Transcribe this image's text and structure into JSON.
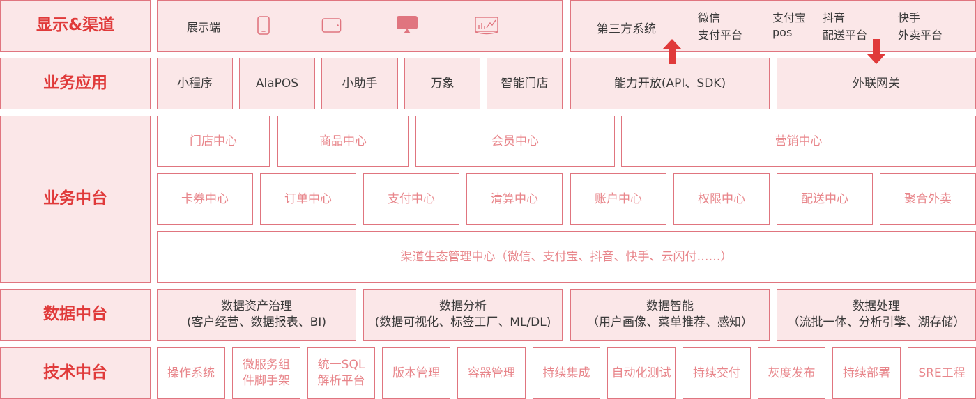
{
  "rows": {
    "display": {
      "label": "显示&渠道",
      "devices_label": "展示端",
      "third_party": {
        "label": "第三方系统",
        "items": [
          [
            "微信",
            "支付平台"
          ],
          [
            "支付宝",
            "pos"
          ],
          [
            "抖音",
            "配送平台"
          ],
          [
            "快手",
            "外卖平台"
          ]
        ]
      }
    },
    "business_apps": {
      "label": "业务应用",
      "items": [
        "小程序",
        "AlaPOS",
        "小助手",
        "万象",
        "智能门店"
      ],
      "open_api": "能力开放(API、SDK)",
      "gateway": "外联网关"
    },
    "business_middle": {
      "label": "业务中台",
      "row1": [
        "门店中心",
        "商品中心",
        "会员中心",
        "营销中心"
      ],
      "row2": [
        "卡券中心",
        "订单中心",
        "支付中心",
        "清算中心",
        "账户中心",
        "权限中心",
        "配送中心",
        "聚合外卖"
      ],
      "channel": "渠道生态管理中心（微信、支付宝、抖音、快手、云闪付……）"
    },
    "data_middle": {
      "label": "数据中台",
      "items": [
        {
          "title": "数据资产治理",
          "sub": "(客户经营、数据报表、BI)"
        },
        {
          "title": "数据分析",
          "sub": "(数据可视化、标签工厂、ML/DL)"
        },
        {
          "title": "数据智能",
          "sub": "（用户画像、菜单推荐、感知）"
        },
        {
          "title": "数据处理",
          "sub": "（流批一体、分析引擎、湖存储）"
        }
      ]
    },
    "tech_middle": {
      "label": "技术中台",
      "items": [
        [
          "操作系统"
        ],
        [
          "微服务组",
          "件脚手架"
        ],
        [
          "统一SQL",
          "解析平台"
        ],
        [
          "版本管理"
        ],
        [
          "容器管理"
        ],
        [
          "持续集成"
        ],
        [
          "自动化测试"
        ],
        [
          "持续交付"
        ],
        [
          "灰度发布"
        ],
        [
          "持续部署"
        ],
        [
          "SRE工程"
        ]
      ]
    }
  },
  "colors": {
    "border": "#e0757f",
    "fill": "#fbe7e8",
    "category_text": "#e03a3a",
    "light_text": "#e8868b",
    "dark_text": "#3a3a3a",
    "arrow": "#e03a3a"
  }
}
